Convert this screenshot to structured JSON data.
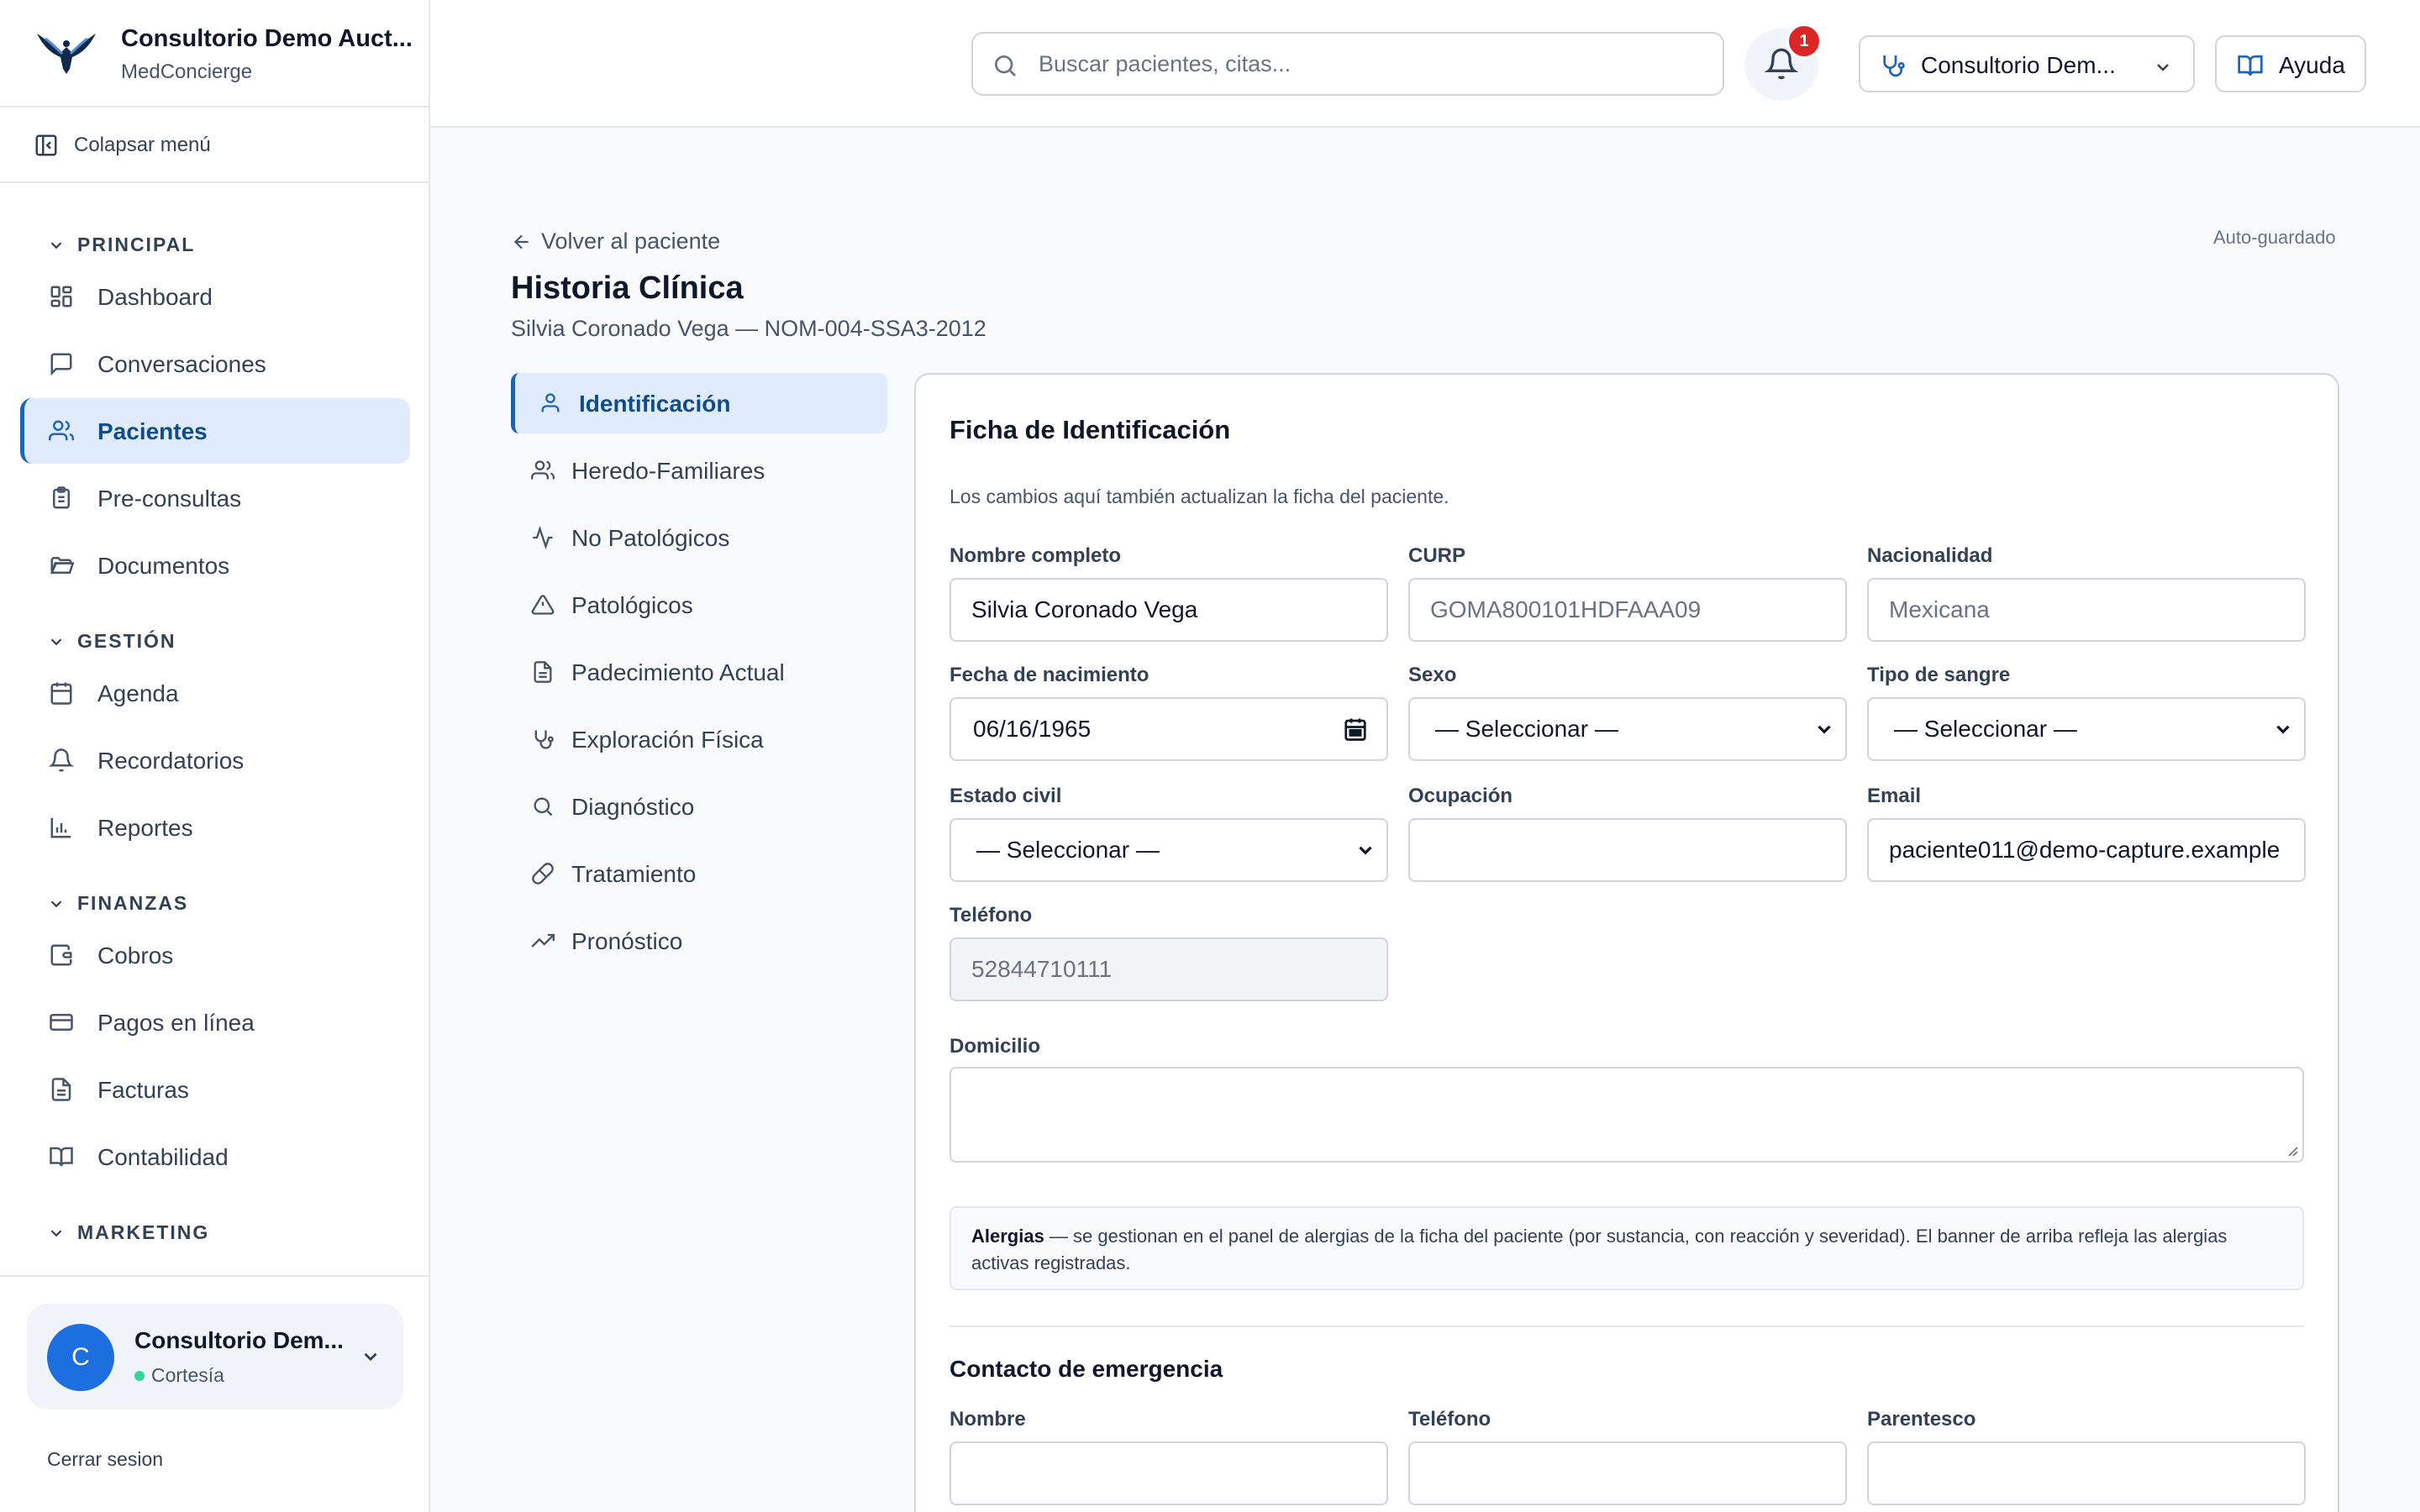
{
  "brand": {
    "name": "Consultorio Demo Auct...",
    "subtitle": "MedConcierge"
  },
  "sidebar": {
    "collapse_label": "Colapsar menú",
    "sections": {
      "principal": "PRINCIPAL",
      "gestion": "GESTIÓN",
      "finanzas": "FINANZAS",
      "marketing": "MARKETING"
    },
    "items": {
      "dashboard": "Dashboard",
      "conversaciones": "Conversaciones",
      "pacientes": "Pacientes",
      "preconsultas": "Pre-consultas",
      "documentos": "Documentos",
      "agenda": "Agenda",
      "recordatorios": "Recordatorios",
      "reportes": "Reportes",
      "cobros": "Cobros",
      "pagos": "Pagos en línea",
      "facturas": "Facturas",
      "contabilidad": "Contabilidad"
    },
    "active_item": "Pacientes",
    "account": {
      "initial": "C",
      "name": "Consultorio Dem...",
      "plan": "Cortesía"
    },
    "logout_label": "Cerrar sesion"
  },
  "header": {
    "search_placeholder": "Buscar pacientes, citas...",
    "notifications_count": "1",
    "clinic_label": "Consultorio Dem...",
    "help_label": "Ayuda"
  },
  "page": {
    "back_label": "Volver al paciente",
    "title": "Historia Clínica",
    "subtitle": "Silvia Coronado Vega — NOM-004-SSA3-2012",
    "autosave": "Auto-guardado"
  },
  "subnav": {
    "identificacion": "Identificación",
    "heredo": "Heredo-Familiares",
    "nopatologicos": "No Patológicos",
    "patologicos": "Patológicos",
    "padecimiento": "Padecimiento Actual",
    "exploracion": "Exploración Física",
    "diagnostico": "Diagnóstico",
    "tratamiento": "Tratamiento",
    "pronostico": "Pronóstico"
  },
  "form": {
    "title": "Ficha de Identificación",
    "note": "Los cambios aquí también actualizan la ficha del paciente.",
    "nombre": {
      "label": "Nombre completo",
      "value": "Silvia Coronado Vega"
    },
    "curp": {
      "label": "CURP",
      "placeholder": "GOMA800101HDFAAA09"
    },
    "nacionalidad": {
      "label": "Nacionalidad",
      "placeholder": "Mexicana"
    },
    "fecha": {
      "label": "Fecha de nacimiento",
      "value": "06/16/1965"
    },
    "sexo": {
      "label": "Sexo",
      "value": "— Seleccionar —"
    },
    "sangre": {
      "label": "Tipo de sangre",
      "value": "— Seleccionar —"
    },
    "estado_civil": {
      "label": "Estado civil",
      "value": "— Seleccionar —"
    },
    "ocupacion": {
      "label": "Ocupación",
      "value": ""
    },
    "email": {
      "label": "Email",
      "value": "paciente011@demo-capture.example"
    },
    "telefono": {
      "label": "Teléfono",
      "value": "52844710111"
    },
    "domicilio": {
      "label": "Domicilio",
      "value": ""
    },
    "alergias": {
      "title": "Alergias",
      "text": " — se gestionan en el panel de alergias de la ficha del paciente (por sustancia, con reacción y severidad). El banner de arriba refleja las alergias activas registradas."
    },
    "emergencia": {
      "title": "Contacto de emergencia",
      "nombre_label": "Nombre",
      "telefono_label": "Teléfono",
      "parentesco_label": "Parentesco"
    }
  },
  "colors": {
    "accent": "#1e63b6",
    "active_bg": "#e0ecfb",
    "badge": "#dc2626",
    "avatar": "#1d6fe0"
  }
}
